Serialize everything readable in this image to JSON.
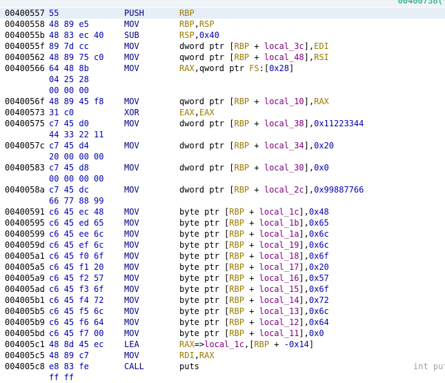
{
  "header": {
    "xref_text": "00400738(*"
  },
  "colors": {
    "register": "#9a7a00",
    "number": "#0000b0",
    "local_var": "#800080",
    "plain": "#000000"
  },
  "rows": [
    {
      "addr": "00400557",
      "bytes": "55",
      "mnem": "PUSH",
      "ops": [
        [
          "r",
          "RBP"
        ]
      ],
      "highlight": true
    },
    {
      "addr": "00400558",
      "bytes": "48 89 e5",
      "mnem": "MOV",
      "ops": [
        [
          "r",
          "RBP"
        ],
        [
          "p",
          ","
        ],
        [
          "r",
          "RSP"
        ]
      ]
    },
    {
      "addr": "0040055b",
      "bytes": "48 83 ec 40",
      "mnem": "SUB",
      "ops": [
        [
          "r",
          "RSP"
        ],
        [
          "p",
          ","
        ],
        [
          "n",
          "0x40"
        ]
      ]
    },
    {
      "addr": "0040055f",
      "bytes": "89 7d cc",
      "mnem": "MOV",
      "ops": [
        [
          "p",
          "dword ptr ["
        ],
        [
          "r",
          "RBP"
        ],
        [
          "p",
          " + "
        ],
        [
          "l",
          "local_3c"
        ],
        [
          "p",
          "],"
        ],
        [
          "r",
          "EDI"
        ]
      ]
    },
    {
      "addr": "00400562",
      "bytes": "48 89 75 c0",
      "mnem": "MOV",
      "ops": [
        [
          "p",
          "qword ptr ["
        ],
        [
          "r",
          "RBP"
        ],
        [
          "p",
          " + "
        ],
        [
          "l",
          "local_48"
        ],
        [
          "p",
          "],"
        ],
        [
          "r",
          "RSI"
        ]
      ]
    },
    {
      "addr": "00400566",
      "bytes": "64 48 8b",
      "mnem": "MOV",
      "ops": [
        [
          "r",
          "RAX"
        ],
        [
          "p",
          ",qword ptr "
        ],
        [
          "r",
          "FS"
        ],
        [
          "p",
          ":["
        ],
        [
          "n",
          "0x28"
        ],
        [
          "p",
          "]"
        ]
      ]
    },
    {
      "addr": "",
      "bytes": "04 25 28",
      "mnem": "",
      "ops": []
    },
    {
      "addr": "",
      "bytes": "00 00 00",
      "mnem": "",
      "ops": []
    },
    {
      "addr": "0040056f",
      "bytes": "48 89 45 f8",
      "mnem": "MOV",
      "ops": [
        [
          "p",
          "qword ptr ["
        ],
        [
          "r",
          "RBP"
        ],
        [
          "p",
          " + "
        ],
        [
          "l",
          "local_10"
        ],
        [
          "p",
          "],"
        ],
        [
          "r",
          "RAX"
        ]
      ]
    },
    {
      "addr": "00400573",
      "bytes": "31 c0",
      "mnem": "XOR",
      "ops": [
        [
          "r",
          "EAX"
        ],
        [
          "p",
          ","
        ],
        [
          "r",
          "EAX"
        ]
      ]
    },
    {
      "addr": "00400575",
      "bytes": "c7 45 d0",
      "mnem": "MOV",
      "ops": [
        [
          "p",
          "dword ptr ["
        ],
        [
          "r",
          "RBP"
        ],
        [
          "p",
          " + "
        ],
        [
          "l",
          "local_38"
        ],
        [
          "p",
          "],"
        ],
        [
          "n",
          "0x11223344"
        ]
      ]
    },
    {
      "addr": "",
      "bytes": "44 33 22 11",
      "mnem": "",
      "ops": []
    },
    {
      "addr": "0040057c",
      "bytes": "c7 45 d4",
      "mnem": "MOV",
      "ops": [
        [
          "p",
          "dword ptr ["
        ],
        [
          "r",
          "RBP"
        ],
        [
          "p",
          " + "
        ],
        [
          "l",
          "local_34"
        ],
        [
          "p",
          "],"
        ],
        [
          "n",
          "0x20"
        ]
      ]
    },
    {
      "addr": "",
      "bytes": "20 00 00 00",
      "mnem": "",
      "ops": []
    },
    {
      "addr": "00400583",
      "bytes": "c7 45 d8",
      "mnem": "MOV",
      "ops": [
        [
          "p",
          "dword ptr ["
        ],
        [
          "r",
          "RBP"
        ],
        [
          "p",
          " + "
        ],
        [
          "l",
          "local_30"
        ],
        [
          "p",
          "],"
        ],
        [
          "n",
          "0x0"
        ]
      ]
    },
    {
      "addr": "",
      "bytes": "00 00 00 00",
      "mnem": "",
      "ops": []
    },
    {
      "addr": "0040058a",
      "bytes": "c7 45 dc",
      "mnem": "MOV",
      "ops": [
        [
          "p",
          "dword ptr ["
        ],
        [
          "r",
          "RBP"
        ],
        [
          "p",
          " + "
        ],
        [
          "l",
          "local_2c"
        ],
        [
          "p",
          "],"
        ],
        [
          "n",
          "0x99887766"
        ]
      ]
    },
    {
      "addr": "",
      "bytes": "66 77 88 99",
      "mnem": "",
      "ops": []
    },
    {
      "addr": "00400591",
      "bytes": "c6 45 ec 48",
      "mnem": "MOV",
      "ops": [
        [
          "p",
          "byte ptr ["
        ],
        [
          "r",
          "RBP"
        ],
        [
          "p",
          " + "
        ],
        [
          "l",
          "local_1c"
        ],
        [
          "p",
          "],"
        ],
        [
          "n",
          "0x48"
        ]
      ]
    },
    {
      "addr": "00400595",
      "bytes": "c6 45 ed 65",
      "mnem": "MOV",
      "ops": [
        [
          "p",
          "byte ptr ["
        ],
        [
          "r",
          "RBP"
        ],
        [
          "p",
          " + "
        ],
        [
          "l",
          "local_1b"
        ],
        [
          "p",
          "],"
        ],
        [
          "n",
          "0x65"
        ]
      ]
    },
    {
      "addr": "00400599",
      "bytes": "c6 45 ee 6c",
      "mnem": "MOV",
      "ops": [
        [
          "p",
          "byte ptr ["
        ],
        [
          "r",
          "RBP"
        ],
        [
          "p",
          " + "
        ],
        [
          "l",
          "local_1a"
        ],
        [
          "p",
          "],"
        ],
        [
          "n",
          "0x6c"
        ]
      ]
    },
    {
      "addr": "0040059d",
      "bytes": "c6 45 ef 6c",
      "mnem": "MOV",
      "ops": [
        [
          "p",
          "byte ptr ["
        ],
        [
          "r",
          "RBP"
        ],
        [
          "p",
          " + "
        ],
        [
          "l",
          "local_19"
        ],
        [
          "p",
          "],"
        ],
        [
          "n",
          "0x6c"
        ]
      ]
    },
    {
      "addr": "004005a1",
      "bytes": "c6 45 f0 6f",
      "mnem": "MOV",
      "ops": [
        [
          "p",
          "byte ptr ["
        ],
        [
          "r",
          "RBP"
        ],
        [
          "p",
          " + "
        ],
        [
          "l",
          "local_18"
        ],
        [
          "p",
          "],"
        ],
        [
          "n",
          "0x6f"
        ]
      ]
    },
    {
      "addr": "004005a5",
      "bytes": "c6 45 f1 20",
      "mnem": "MOV",
      "ops": [
        [
          "p",
          "byte ptr ["
        ],
        [
          "r",
          "RBP"
        ],
        [
          "p",
          " + "
        ],
        [
          "l",
          "local_17"
        ],
        [
          "p",
          "],"
        ],
        [
          "n",
          "0x20"
        ]
      ]
    },
    {
      "addr": "004005a9",
      "bytes": "c6 45 f2 57",
      "mnem": "MOV",
      "ops": [
        [
          "p",
          "byte ptr ["
        ],
        [
          "r",
          "RBP"
        ],
        [
          "p",
          " + "
        ],
        [
          "l",
          "local_16"
        ],
        [
          "p",
          "],"
        ],
        [
          "n",
          "0x57"
        ]
      ]
    },
    {
      "addr": "004005ad",
      "bytes": "c6 45 f3 6f",
      "mnem": "MOV",
      "ops": [
        [
          "p",
          "byte ptr ["
        ],
        [
          "r",
          "RBP"
        ],
        [
          "p",
          " + "
        ],
        [
          "l",
          "local_15"
        ],
        [
          "p",
          "],"
        ],
        [
          "n",
          "0x6f"
        ]
      ]
    },
    {
      "addr": "004005b1",
      "bytes": "c6 45 f4 72",
      "mnem": "MOV",
      "ops": [
        [
          "p",
          "byte ptr ["
        ],
        [
          "r",
          "RBP"
        ],
        [
          "p",
          " + "
        ],
        [
          "l",
          "local_14"
        ],
        [
          "p",
          "],"
        ],
        [
          "n",
          "0x72"
        ]
      ]
    },
    {
      "addr": "004005b5",
      "bytes": "c6 45 f5 6c",
      "mnem": "MOV",
      "ops": [
        [
          "p",
          "byte ptr ["
        ],
        [
          "r",
          "RBP"
        ],
        [
          "p",
          " + "
        ],
        [
          "l",
          "local_13"
        ],
        [
          "p",
          "],"
        ],
        [
          "n",
          "0x6c"
        ]
      ]
    },
    {
      "addr": "004005b9",
      "bytes": "c6 45 f6 64",
      "mnem": "MOV",
      "ops": [
        [
          "p",
          "byte ptr ["
        ],
        [
          "r",
          "RBP"
        ],
        [
          "p",
          " + "
        ],
        [
          "l",
          "local_12"
        ],
        [
          "p",
          "],"
        ],
        [
          "n",
          "0x64"
        ]
      ]
    },
    {
      "addr": "004005bd",
      "bytes": "c6 45 f7 00",
      "mnem": "MOV",
      "ops": [
        [
          "p",
          "byte ptr ["
        ],
        [
          "r",
          "RBP"
        ],
        [
          "p",
          " + "
        ],
        [
          "l",
          "local_11"
        ],
        [
          "p",
          "],"
        ],
        [
          "n",
          "0x0"
        ]
      ]
    },
    {
      "addr": "004005c1",
      "bytes": "48 8d 45 ec",
      "mnem": "LEA",
      "ops": [
        [
          "r",
          "RAX"
        ],
        [
          "p",
          "=>"
        ],
        [
          "l",
          "local_1c"
        ],
        [
          "p",
          ",["
        ],
        [
          "r",
          "RBP"
        ],
        [
          "p",
          " + "
        ],
        [
          "n",
          "-0x14"
        ],
        [
          "p",
          "]"
        ]
      ]
    },
    {
      "addr": "004005c5",
      "bytes": "48 89 c7",
      "mnem": "MOV",
      "ops": [
        [
          "r",
          "RDI"
        ],
        [
          "p",
          ","
        ],
        [
          "r",
          "RAX"
        ]
      ]
    },
    {
      "addr": "004005c8",
      "bytes": "e8 83 fe",
      "mnem": "CALL",
      "ops": [
        [
          "p",
          "puts"
        ]
      ],
      "sig": "int put"
    },
    {
      "addr": "",
      "bytes": "ff ff",
      "mnem": "",
      "ops": []
    }
  ]
}
